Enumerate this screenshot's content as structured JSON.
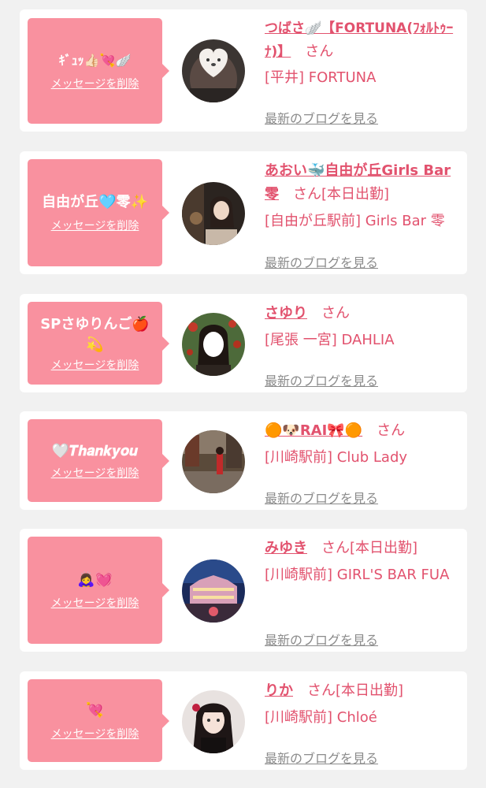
{
  "delete_label": "メッセージを削除",
  "blog_label": "最新のブログを見る",
  "san": "さん",
  "colors": {
    "accent": "#e2526e",
    "bubble": "#f9919f",
    "link_gray": "#8b8b8b"
  },
  "items": [
    {
      "message": "ｷﾞｭｯ👍🏻💘🪽",
      "name": "つばさ🪽【FORTUNA(ﾌｫﾙﾄｩｰﾅ)】",
      "status": "",
      "shop": "[平井] FORTUNA"
    },
    {
      "message": "自由が丘🩵零✨",
      "name": "あおい🐳自由が丘Girls Bar零",
      "status": "[本日出勤]",
      "shop": "[自由が丘駅前] Girls Bar 零"
    },
    {
      "message": "SPさゆりんご🍎💫",
      "name": "さゆり",
      "status": "",
      "shop": "[尾張 一宮] DAHLIA"
    },
    {
      "message": "🤍𝑻𝒉𝒂𝒏𝒌𝒚𝒐𝒖",
      "name": "🟠🐶RAI🎀🟠",
      "status": "",
      "shop": "[川崎駅前] Club Lady"
    },
    {
      "message": "🙇‍♀️💓",
      "name": "みゆき",
      "status": "[本日出勤]",
      "shop": "[川崎駅前] GIRL'S BAR FUA"
    },
    {
      "message": "💘",
      "name": "りか",
      "status": "[本日出勤]",
      "shop": "[川崎駅前] Chloé"
    }
  ]
}
